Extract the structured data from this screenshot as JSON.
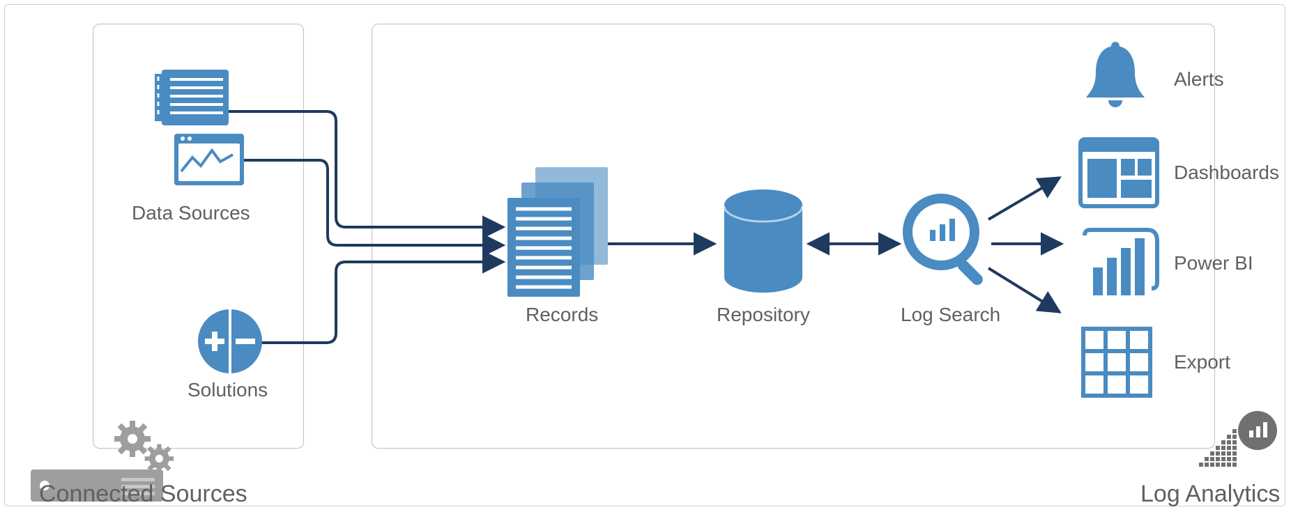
{
  "colors": {
    "accent": "#4A8BC2",
    "dark": "#1E3A5F",
    "gray": "#9E9E9E",
    "grayDark": "#707070",
    "text": "#606060",
    "border": "#bfbfbf"
  },
  "labels": {
    "connected_sources": "Connected Sources",
    "data_sources": "Data Sources",
    "solutions": "Solutions",
    "records": "Records",
    "repository": "Repository",
    "log_search": "Log Search",
    "alerts": "Alerts",
    "dashboards": "Dashboards",
    "power_bi": "Power BI",
    "export": "Export",
    "log_analytics": "Log Analytics"
  }
}
